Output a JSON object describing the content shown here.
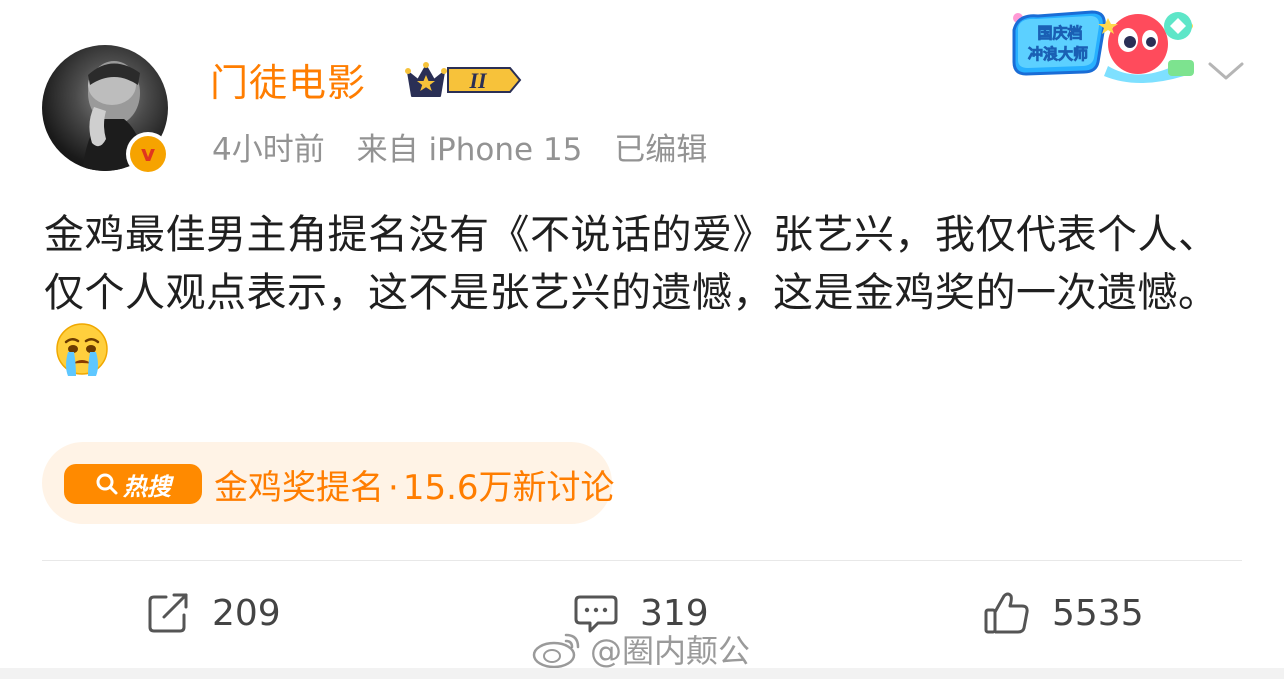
{
  "post": {
    "author": {
      "name": "门徒电影",
      "vip_level": "II",
      "avatar_icon": "avatar-photo",
      "verified_mark": "v"
    },
    "meta": {
      "time": "4小时前",
      "source": "来自 iPhone 15",
      "edited": "已编辑"
    },
    "festival_badge": {
      "line1": "国庆档",
      "line2": "冲浪大师"
    },
    "content": {
      "text": "金鸡最佳男主角提名没有《不说话的爱》张艺兴，我仅代表个人、仅个人观点表示，这不是张艺兴的遗憾，这是金鸡奖的一次遗憾。",
      "emoji": "crying-face-emoji"
    },
    "hot_search": {
      "tag": "热搜",
      "topic": "金鸡奖提名",
      "separator": "·",
      "stats": "15.6万新讨论"
    },
    "actions": {
      "repost_count": "209",
      "comment_count": "319",
      "like_count": "5535"
    },
    "watermark": "@圈内颠公"
  },
  "colors": {
    "accent": "#ff7d00",
    "meta_text": "#939393",
    "body_text": "#1f1f1f",
    "hot_bg": "#fff3e6",
    "hot_tag_bg": "#ff8a00"
  }
}
